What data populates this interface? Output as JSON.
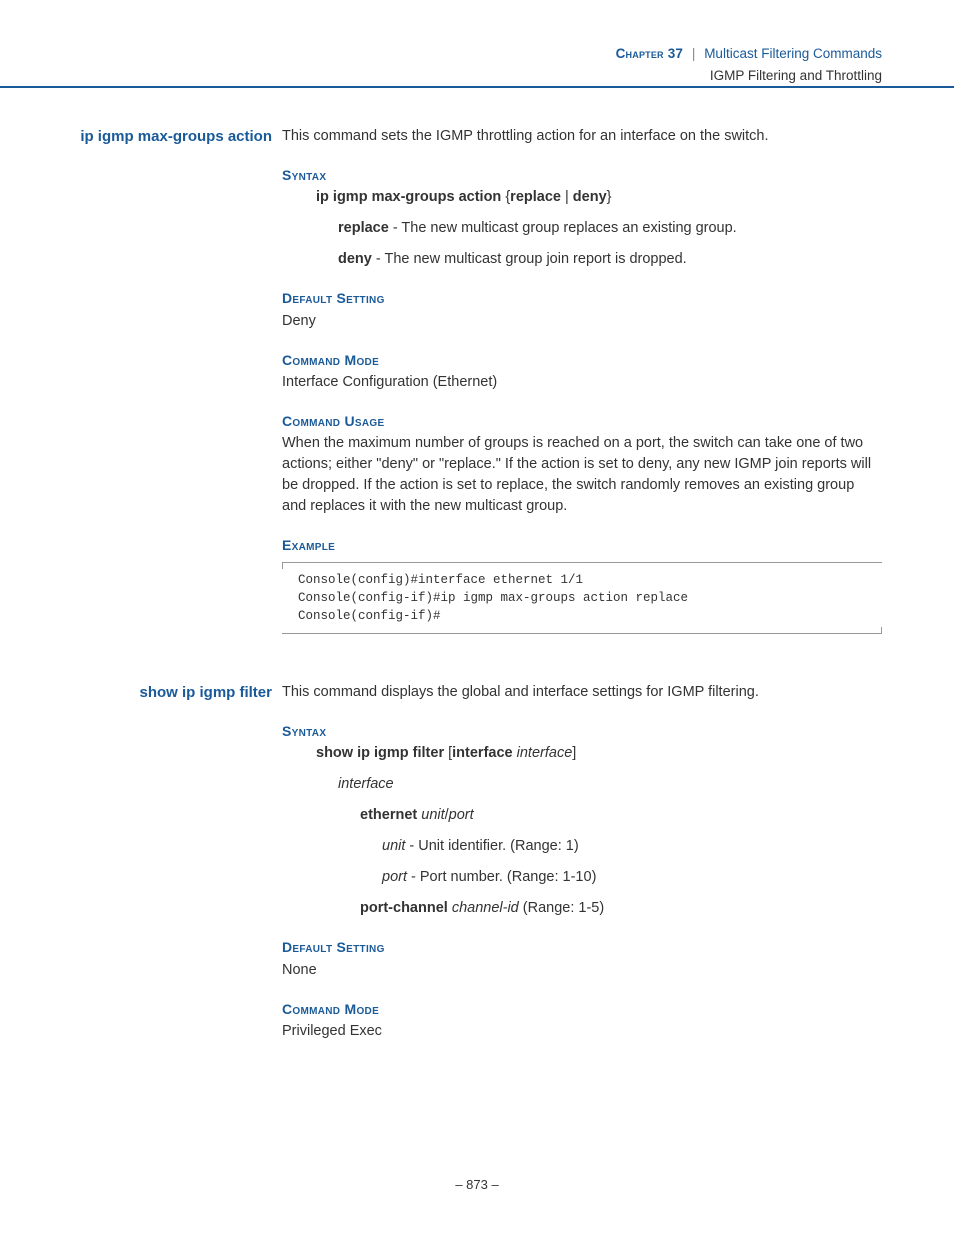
{
  "header": {
    "chapter_label": "Chapter 37",
    "separator": "|",
    "chapter_title": "Multicast Filtering Commands",
    "section": "IGMP Filtering and Throttling"
  },
  "commands": [
    {
      "name": "ip igmp max-groups action",
      "desc": "This command sets the IGMP throttling action for an interface on the switch.",
      "syntax_head": "Syntax",
      "syntax_line": "ip igmp max-groups action {replace | deny}",
      "params": [
        {
          "term": "replace",
          "text": " - The new multicast group replaces an existing group."
        },
        {
          "term": "deny",
          "text": " - The new multicast group join report is dropped."
        }
      ],
      "default_head": "Default Setting",
      "default_val": "Deny",
      "mode_head": "Command Mode",
      "mode_val": "Interface Configuration (Ethernet)",
      "usage_head": "Command Usage",
      "usage_val": "When the maximum number of groups is reached on a port, the switch can take one of two actions; either \"deny\" or \"replace.\" If the action is set to deny, any new IGMP join reports will be dropped. If the action is set to replace, the switch randomly removes an existing group and replaces it with the new multicast group.",
      "example_head": "Example",
      "example_code": "Console(config)#interface ethernet 1/1\nConsole(config-if)#ip igmp max-groups action replace\nConsole(config-if)#"
    },
    {
      "name": "show ip igmp filter",
      "desc": "This command displays the global and interface settings for IGMP filtering.",
      "syntax_head": "Syntax",
      "default_head": "Default Setting",
      "default_val": "None",
      "mode_head": "Command Mode",
      "mode_val": "Privileged Exec"
    }
  ],
  "syntax2": {
    "line": {
      "pre": "show ip igmp filter ",
      "br1": "[",
      "kw": "interface",
      "sp": " ",
      "arg": "interface",
      "br2": "]"
    },
    "iface": "interface",
    "eth_kw": "ethernet ",
    "eth_arg1": "unit",
    "eth_slash": "/",
    "eth_arg2": "port",
    "unit_it": "unit",
    "unit_txt": " - Unit identifier. (Range: 1)",
    "port_it": "port",
    "port_txt": " - Port number. (Range: 1-10)",
    "pc_kw": "port-channel ",
    "pc_arg": "channel-id",
    "pc_txt": " (Range: 1-5)"
  },
  "footer": {
    "page": "– 873 –"
  }
}
